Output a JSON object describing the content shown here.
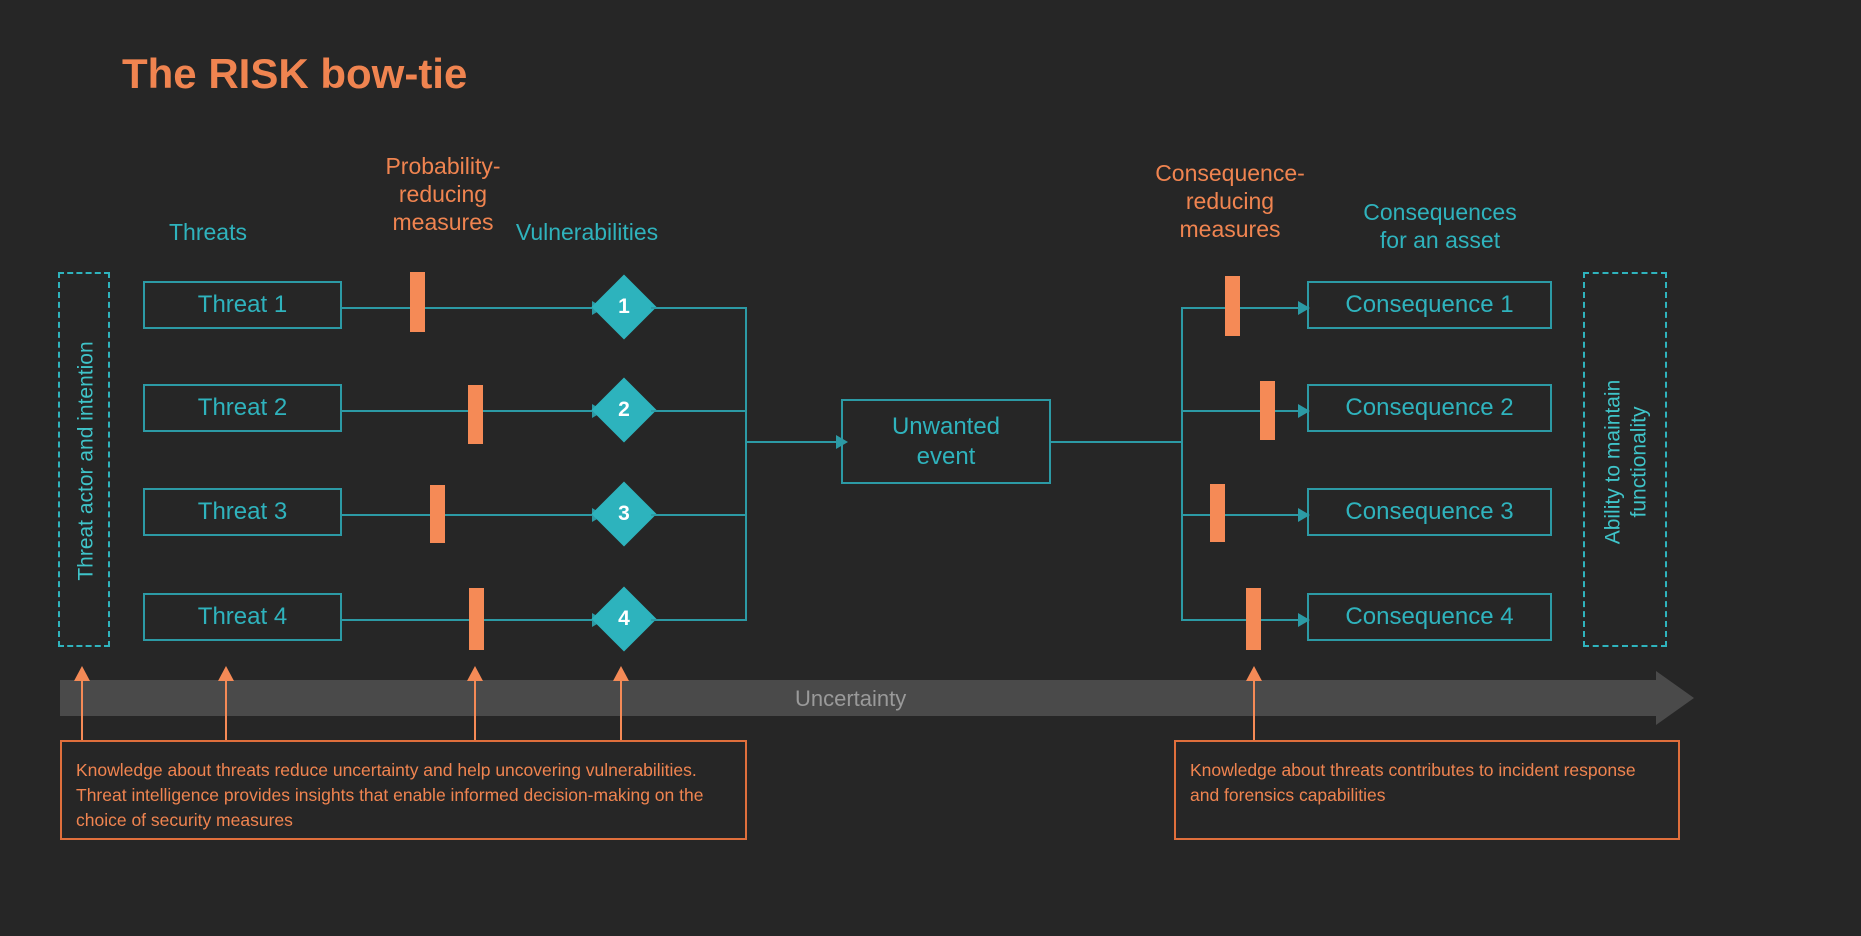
{
  "title": "The RISK bow-tie",
  "colors": {
    "background": "#262626",
    "accent_orange": "#f08450",
    "accent_teal": "#2fb3bd",
    "measure_orange": "#f58a56",
    "uncertainty_grey": "#4a4a4a"
  },
  "headings": {
    "threats": "Threats",
    "probability_reducing_measures": "Probability-\nreducing\nmeasures",
    "vulnerabilities": "Vulnerabilities",
    "consequence_reducing_measures": "Consequence-\nreducing\nmeasures",
    "consequences_for_an_asset": "Consequences\nfor an asset"
  },
  "side_panels": {
    "left": "Threat actor and intention",
    "right": "Ability to maintain\nfunctionality"
  },
  "threats": [
    {
      "label": "Threat 1"
    },
    {
      "label": "Threat 2"
    },
    {
      "label": "Threat 3"
    },
    {
      "label": "Threat 4"
    }
  ],
  "vulnerabilities": [
    {
      "label": "1"
    },
    {
      "label": "2"
    },
    {
      "label": "3"
    },
    {
      "label": "4"
    }
  ],
  "center": {
    "unwanted_event": "Unwanted\nevent"
  },
  "consequences": [
    {
      "label": "Consequence 1"
    },
    {
      "label": "Consequence 2"
    },
    {
      "label": "Consequence 3"
    },
    {
      "label": "Consequence 4"
    }
  ],
  "uncertainty": {
    "label": "Uncertainty"
  },
  "annotations": {
    "left": "Knowledge about threats reduce uncertainty and help uncovering vulnerabilities. Threat intelligence provides insights that enable informed decision-making on the choice of security measures",
    "right": "Knowledge about threats contributes to incident response and forensics capabilities"
  }
}
